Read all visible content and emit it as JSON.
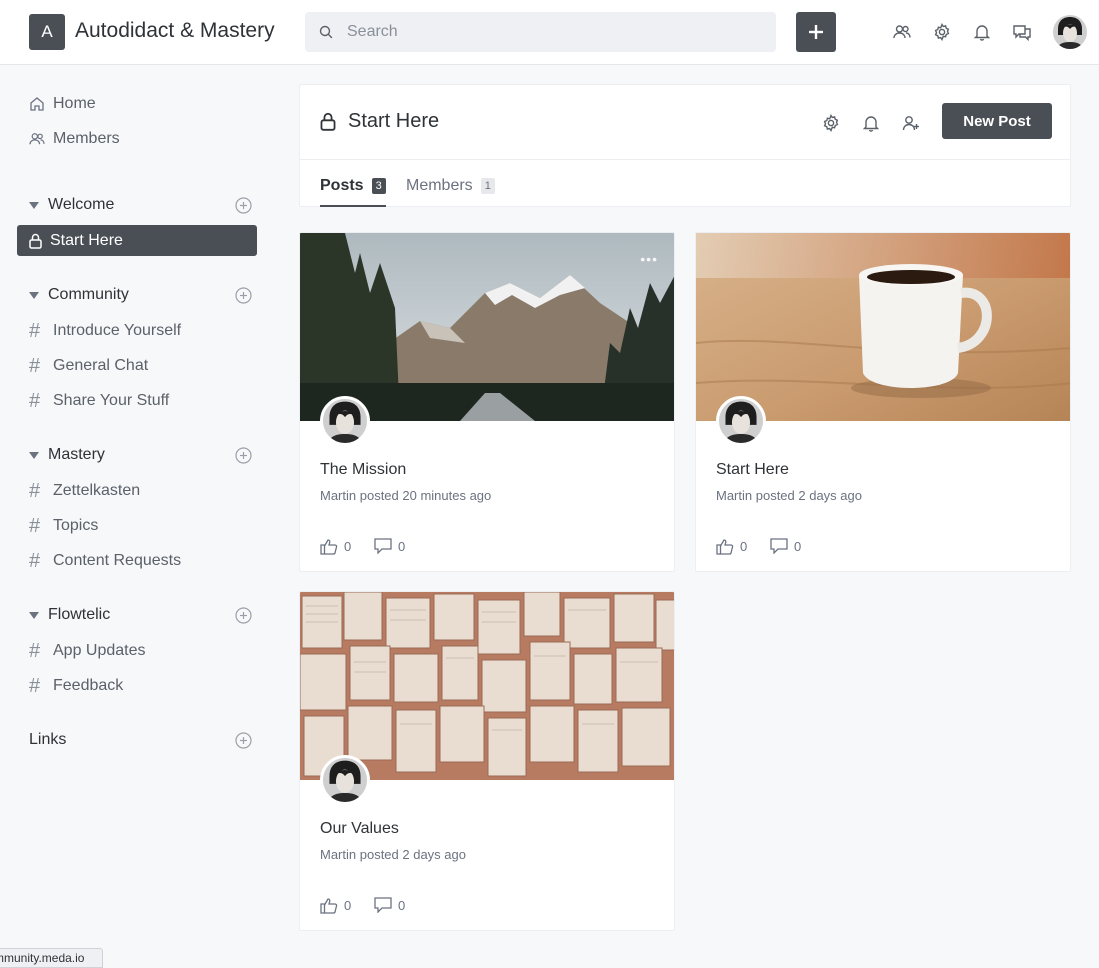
{
  "header": {
    "logo_letter": "A",
    "app_title": "Autodidact & Mastery",
    "search_placeholder": "Search"
  },
  "sidebar": {
    "nav": [
      {
        "label": "Home",
        "icon": "home-icon"
      },
      {
        "label": "Members",
        "icon": "members-icon"
      }
    ],
    "sections": [
      {
        "label": "Welcome",
        "items": [
          {
            "label": "Start Here",
            "icon": "lock-icon",
            "active": true
          }
        ]
      },
      {
        "label": "Community",
        "items": [
          {
            "label": "Introduce Yourself"
          },
          {
            "label": "General Chat"
          },
          {
            "label": "Share Your Stuff"
          }
        ]
      },
      {
        "label": "Mastery",
        "items": [
          {
            "label": "Zettelkasten"
          },
          {
            "label": "Topics"
          },
          {
            "label": "Content Requests"
          }
        ]
      },
      {
        "label": "Flowtelic",
        "items": [
          {
            "label": "App Updates"
          },
          {
            "label": "Feedback"
          }
        ]
      }
    ],
    "links_label": "Links"
  },
  "space": {
    "title": "Start Here",
    "new_post_label": "New Post",
    "tabs": [
      {
        "label": "Posts",
        "count": "3",
        "active": true
      },
      {
        "label": "Members",
        "count": "1",
        "active": false
      }
    ]
  },
  "posts": [
    {
      "title": "The Mission",
      "meta": "Martin posted 20 minutes ago",
      "likes": "0",
      "comments": "0",
      "cover": "mountain-road"
    },
    {
      "title": "Start Here",
      "meta": "Martin posted 2 days ago",
      "likes": "0",
      "comments": "0",
      "cover": "coffee-mug"
    },
    {
      "title": "Our Values",
      "meta": "Martin posted 2 days ago",
      "likes": "0",
      "comments": "0",
      "cover": "open-books"
    }
  ],
  "status_bar": {
    "url": "mmunity.meda.io"
  },
  "colors": {
    "accent": "#4a4f55",
    "background": "#f7f8fa"
  }
}
